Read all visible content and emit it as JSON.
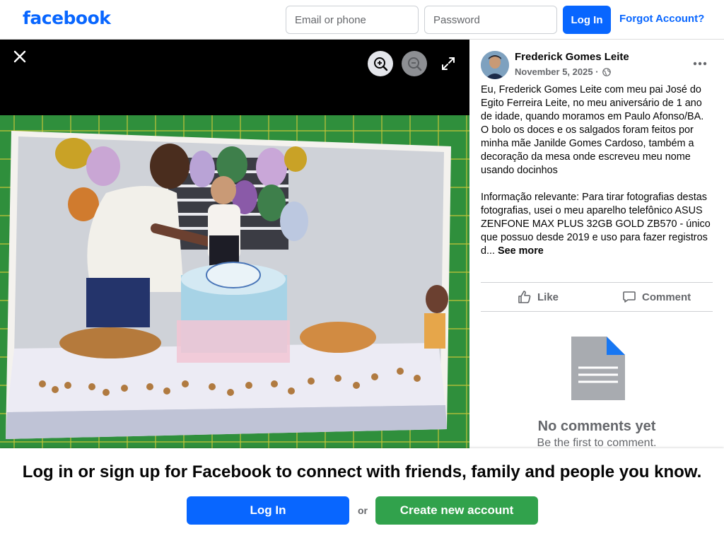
{
  "header": {
    "logo_text": "facebook",
    "email_placeholder": "Email or phone",
    "password_placeholder": "Password",
    "login_label": "Log In",
    "forgot_label": "Forgot Account?"
  },
  "viewer": {
    "close_icon": "close-icon",
    "zoom_in_icon": "zoom-in-icon",
    "zoom_out_icon": "zoom-out-icon",
    "fullscreen_icon": "fullscreen-icon"
  },
  "post": {
    "author": "Frederick Gomes Leite",
    "date": "November 5, 2025",
    "separator": "·",
    "privacy_icon": "globe-icon",
    "text": "Eu, Frederick Gomes Leite com meu pai José do Egito Ferreira Leite, no meu aniversário de 1 ano de idade, quando moramos em Paulo Afonso/BA. O bolo os doces e os salgados foram feitos por minha mãe Janilde Gomes Cardoso, também a decoração da mesa onde escreveu meu nome usando docinhos\n\nInformação relevante: Para tirar fotografias destas fotografias, usei o meu aparelho telefônico ASUS ZENFONE MAX PLUS 32GB GOLD ZB570 - único que possuo desde 2019 e uso para fazer registros d...",
    "see_more": "See more",
    "like_label": "Like",
    "comment_label": "Comment"
  },
  "comments": {
    "empty_title": "No comments yet",
    "empty_subtitle": "Be the first to comment."
  },
  "banner": {
    "text": "Log in or sign up for Facebook to connect with friends, family and people you know.",
    "login_label": "Log In",
    "or_label": "or",
    "create_label": "Create new account"
  },
  "colors": {
    "brand_blue": "#0866ff",
    "create_green": "#31a24c",
    "secondary_text": "#65676b"
  }
}
